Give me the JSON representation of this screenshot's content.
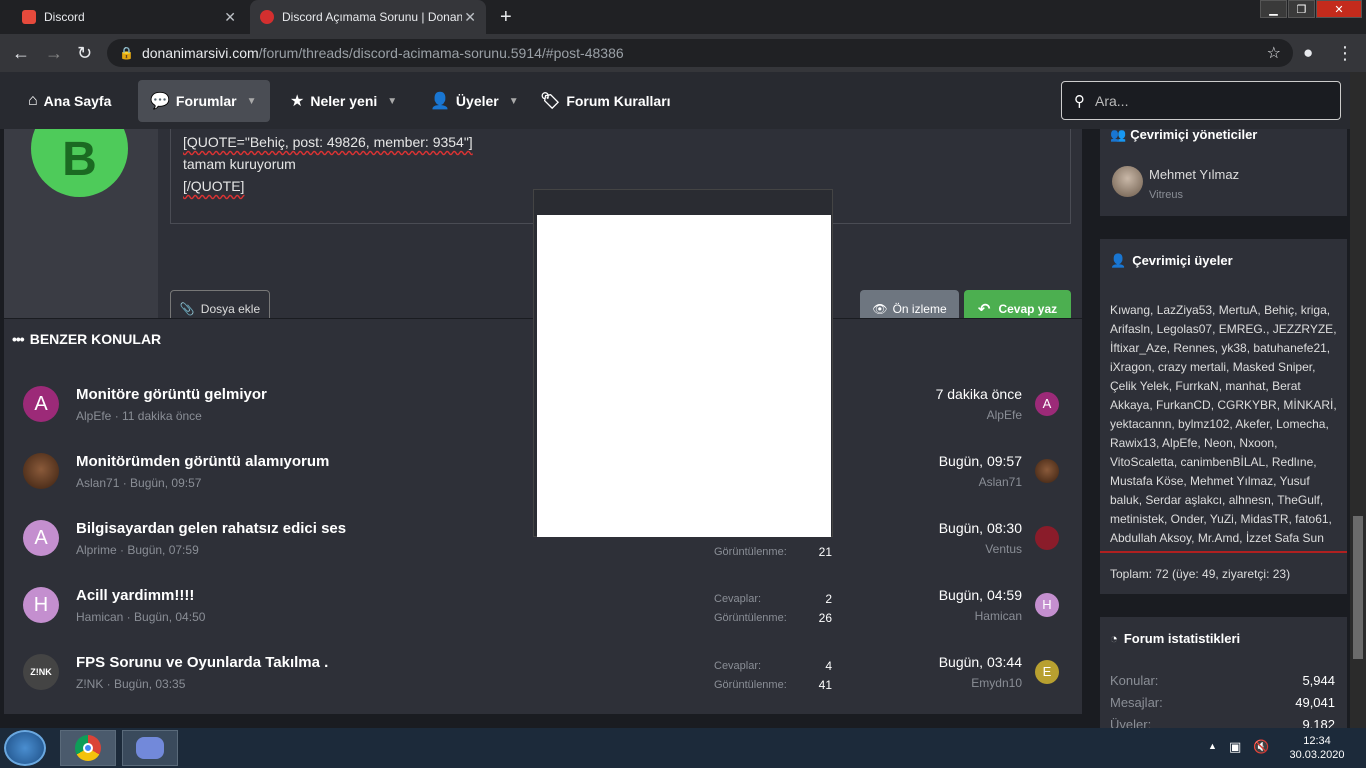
{
  "browser": {
    "tabs": [
      {
        "title": "Discord",
        "favicon_color": "#e64a3c"
      },
      {
        "title": "Discord Açımama Sorunu | Donanım Arşivi",
        "favicon_color": "#d32f2f"
      }
    ],
    "address": {
      "host": "donanimarsivi.com",
      "path": "/forum/threads/discord-acimama-sorunu.5914/#post-48386"
    }
  },
  "nav": {
    "items": [
      {
        "label": "Ana Sayfa"
      },
      {
        "label": "Forumlar"
      },
      {
        "label": "Neler yeni"
      },
      {
        "label": "Üyeler"
      },
      {
        "label": "Forum Kuralları"
      }
    ],
    "search_placeholder": "Ara..."
  },
  "reply": {
    "avatar_letter": "B",
    "lines": [
      "[QUOTE=\"Behiç, post: 49826, member: 9354\"]",
      "tamam kuruyorum",
      "[/QUOTE]"
    ],
    "attach_label": "Dosya ekle",
    "preview_label": "Ön izleme",
    "reply_label": "Cevap yaz"
  },
  "similar": {
    "heading": "BENZER KONULAR",
    "label_replies": "Cevaplar:",
    "label_views": "Görüntülenme:",
    "threads": [
      {
        "avatar": "A",
        "avatar_color": "#9c2a78",
        "title": "Monitöre görüntü gelmiyor",
        "meta": "AlpEfe · 11 dakika önce",
        "replies": "",
        "views": "",
        "last_time": "7 dakika önce",
        "last_user": "AlpEfe",
        "last_avatar": "A",
        "last_avatar_color": "#9c2a78"
      },
      {
        "avatar": "",
        "avatar_color": "#6a3a22",
        "title": "Monitörümden görüntü alamıyorum",
        "meta": "Aslan71 · Bugün, 09:57",
        "replies": "",
        "views": "",
        "last_time": "Bugün, 09:57",
        "last_user": "Aslan71",
        "last_avatar": "",
        "last_avatar_color": "#6a3a22"
      },
      {
        "avatar": "A",
        "avatar_color": "#c48fcf",
        "title": "Bilgisayardan gelen rahatsız edici ses",
        "meta": "Alprime · Bugün, 07:59",
        "replies": "",
        "views": "21",
        "last_time": "Bugün, 08:30",
        "last_user": "Ventus",
        "last_avatar": "",
        "last_avatar_color": "#8a1c2a"
      },
      {
        "avatar": "H",
        "avatar_color": "#c48fcf",
        "title": "Acill yardimm!!!!",
        "meta": "Hamican · Bugün, 04:50",
        "replies": "2",
        "views": "26",
        "last_time": "Bugün, 04:59",
        "last_user": "Hamican",
        "last_avatar": "H",
        "last_avatar_color": "#c48fcf"
      },
      {
        "avatar": "Z!NK",
        "avatar_color": "#444444",
        "title": "FPS Sorunu ve Oyunlarda Takılma .",
        "meta": "Z!NK · Bugün, 03:35",
        "replies": "4",
        "views": "41",
        "last_time": "Bugün, 03:44",
        "last_user": "Emydn10",
        "last_avatar": "E",
        "last_avatar_color": "#b8a030"
      }
    ]
  },
  "sidebar": {
    "staff": {
      "title": "Çevrimiçi yöneticiler",
      "name": "Mehmet Yılmaz",
      "role": "Vitreus"
    },
    "online": {
      "title": "Çevrimiçi üyeler",
      "members": "Kıwang, LazZiya53, MertuA, Behiç, kriga, Arifasln, Legolas07, EMREG., JEZZRYZE, İftixar_Aze, Rennes, yk38, batuhanefe21, iXragon, crazy mertali, Masked Sniper, Çelik Yelek, FurrkaN, manhat, Berat Akkaya, FurkanCD, CGRKYBR, MİNKARİ, yektacannn, bylmz102, Akefer, Lomecha, Rawix13, AlpEfe, Neon, Nxoon, VitoScaletta, canimbenBİLAL, Redlıne, Mustafa Köse, Mehmet Yılmaz, Yusuf baluk, Serdar aşlakcı, alhnesn, TheGulf, metinistek, Onder, YuZi, MidasTR, fato61, Abdullah Aksoy, Mr.Amd, İzzet Safa Sun",
      "total": "Toplam: 72 (üye: 49, ziyaretçi: 23)"
    },
    "stats": {
      "title": "Forum istatistikleri",
      "rows": [
        {
          "label": "Konular:",
          "value": "5,944"
        },
        {
          "label": "Mesajlar:",
          "value": "49,041"
        },
        {
          "label": "Üyeler:",
          "value": "9,182"
        }
      ]
    }
  },
  "taskbar": {
    "time": "12:34",
    "date": "30.03.2020"
  }
}
